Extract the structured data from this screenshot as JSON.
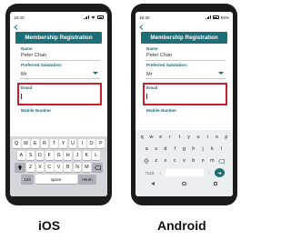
{
  "ios": {
    "platform_label": "iOS",
    "time": "18:30",
    "header_title": "Membership Registration",
    "name_label": "Name",
    "name_value": "Peter Chan",
    "salutation_label": "Preferred Salutation:",
    "salutation_value": "Mr",
    "email_label": "Email",
    "email_value": "",
    "mobile_label": "Mobile Number",
    "keyboard": {
      "row1": [
        "Q",
        "W",
        "E",
        "R",
        "T",
        "Y",
        "U",
        "I",
        "O",
        "P"
      ],
      "row2": [
        "A",
        "S",
        "D",
        "F",
        "G",
        "H",
        "J",
        "K",
        "L"
      ],
      "row3": [
        "Z",
        "X",
        "C",
        "V",
        "B",
        "N",
        "M"
      ],
      "numbers_key": "123",
      "space_key": "space",
      "return_key": "return"
    }
  },
  "android": {
    "platform_label": "Android",
    "time": "18:30",
    "battery": "55%",
    "header_title": "Membership Registration",
    "name_label": "Name",
    "name_value": "Peter Chan",
    "salutation_label": "Preferred Salutation:",
    "salutation_value": "Mr",
    "email_label": "Email",
    "email_value": "",
    "mobile_label": "Mobile Number",
    "keyboard": {
      "row1": [
        "q",
        "w",
        "e",
        "r",
        "t",
        "y",
        "u",
        "i",
        "o",
        "p"
      ],
      "row2": [
        "a",
        "s",
        "d",
        "f",
        "g",
        "h",
        "j",
        "k",
        "l"
      ],
      "row3": [
        "z",
        "x",
        "c",
        "v",
        "b",
        "n",
        "m"
      ],
      "symbols_key": "?123",
      "comma_key": ",",
      "period_key": "."
    }
  },
  "colors": {
    "accent": "#1e6e77",
    "highlight": "#c81e2d"
  }
}
